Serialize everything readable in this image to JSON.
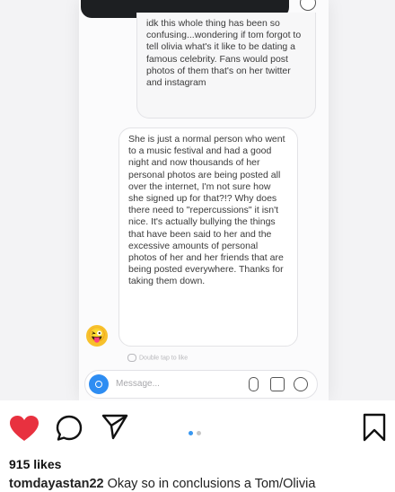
{
  "chat": {
    "message_top": "idk this whole thing has been so confusing...wondering if tom forgot to tell olivia what's it like to be dating a famous celebrity. Fans would post photos of them that's on her twitter and instagram",
    "message_main": "She is just a normal person who went to a music festival and had a good night and now thousands of her personal photos are being posted all over the internet, I'm not sure how she signed up for that?!? Why does there need to \"repercussions\" it isn't nice. It's actually bullying the things that have been said to her and the excessive amounts of personal photos of her and her friends that are being posted everywhere. Thanks for taking them down.",
    "sender_emoji": "😜",
    "seen_text": "Double tap to like",
    "compose_placeholder": "Message..."
  },
  "post": {
    "likes": "915 likes",
    "username": "tomdayastan22",
    "caption": "Okay so in conclusions a Tom/Olivia"
  },
  "colors": {
    "heart": "#e8313f",
    "dot_active": "#3897f0",
    "dot_inactive": "#c7c7c7",
    "camera": "#2e8df2"
  }
}
